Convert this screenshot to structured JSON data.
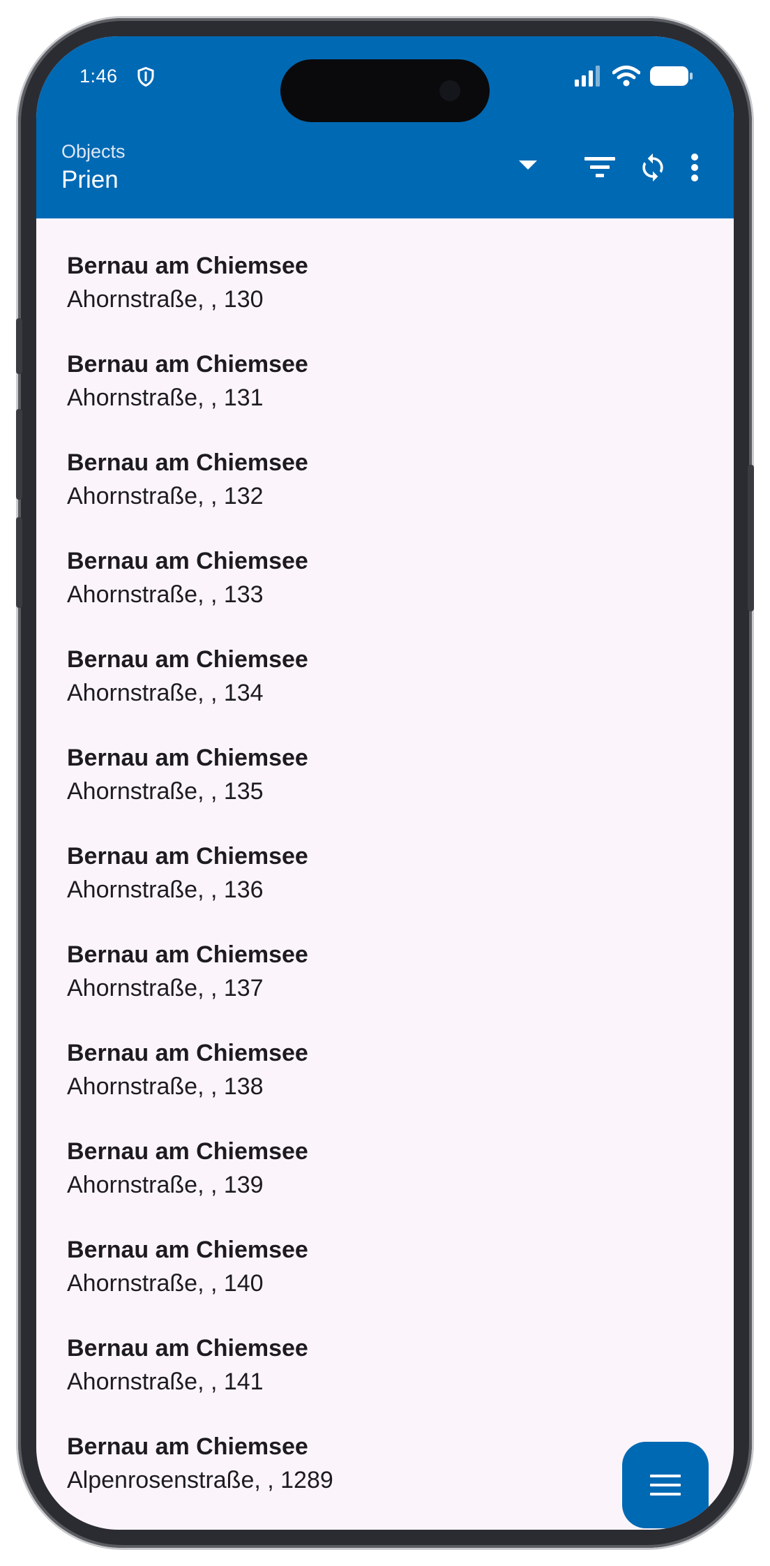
{
  "status_bar": {
    "time": "1:46",
    "shield_icon": "shield-icon",
    "signal_icon": "signal-icon",
    "wifi_icon": "wifi-icon",
    "battery_icon": "battery-icon"
  },
  "app_bar": {
    "subtitle": "Objects",
    "title": "Prien",
    "dropdown_icon": "arrow-drop-down-icon",
    "actions": [
      "filter-icon",
      "sync-icon",
      "more-vert-icon"
    ]
  },
  "list": {
    "items": [
      {
        "title": "Bernau am Chiemsee",
        "subtitle": "Ahornstraße, , 130"
      },
      {
        "title": "Bernau am Chiemsee",
        "subtitle": "Ahornstraße, , 131"
      },
      {
        "title": "Bernau am Chiemsee",
        "subtitle": "Ahornstraße, , 132"
      },
      {
        "title": "Bernau am Chiemsee",
        "subtitle": "Ahornstraße, , 133"
      },
      {
        "title": "Bernau am Chiemsee",
        "subtitle": "Ahornstraße, , 134"
      },
      {
        "title": "Bernau am Chiemsee",
        "subtitle": "Ahornstraße, , 135"
      },
      {
        "title": "Bernau am Chiemsee",
        "subtitle": "Ahornstraße, , 136"
      },
      {
        "title": "Bernau am Chiemsee",
        "subtitle": "Ahornstraße, , 137"
      },
      {
        "title": "Bernau am Chiemsee",
        "subtitle": "Ahornstraße, , 138"
      },
      {
        "title": "Bernau am Chiemsee",
        "subtitle": "Ahornstraße, , 139"
      },
      {
        "title": "Bernau am Chiemsee",
        "subtitle": "Ahornstraße, , 140"
      },
      {
        "title": "Bernau am Chiemsee",
        "subtitle": "Ahornstraße, , 141"
      },
      {
        "title": "Bernau am Chiemsee",
        "subtitle": "Alpenrosenstraße, , 1289"
      }
    ]
  },
  "fab": {
    "icon": "menu-icon"
  },
  "colors": {
    "primary": "#0069b4",
    "background": "#fbf5fb",
    "text": "#1d1b20"
  }
}
